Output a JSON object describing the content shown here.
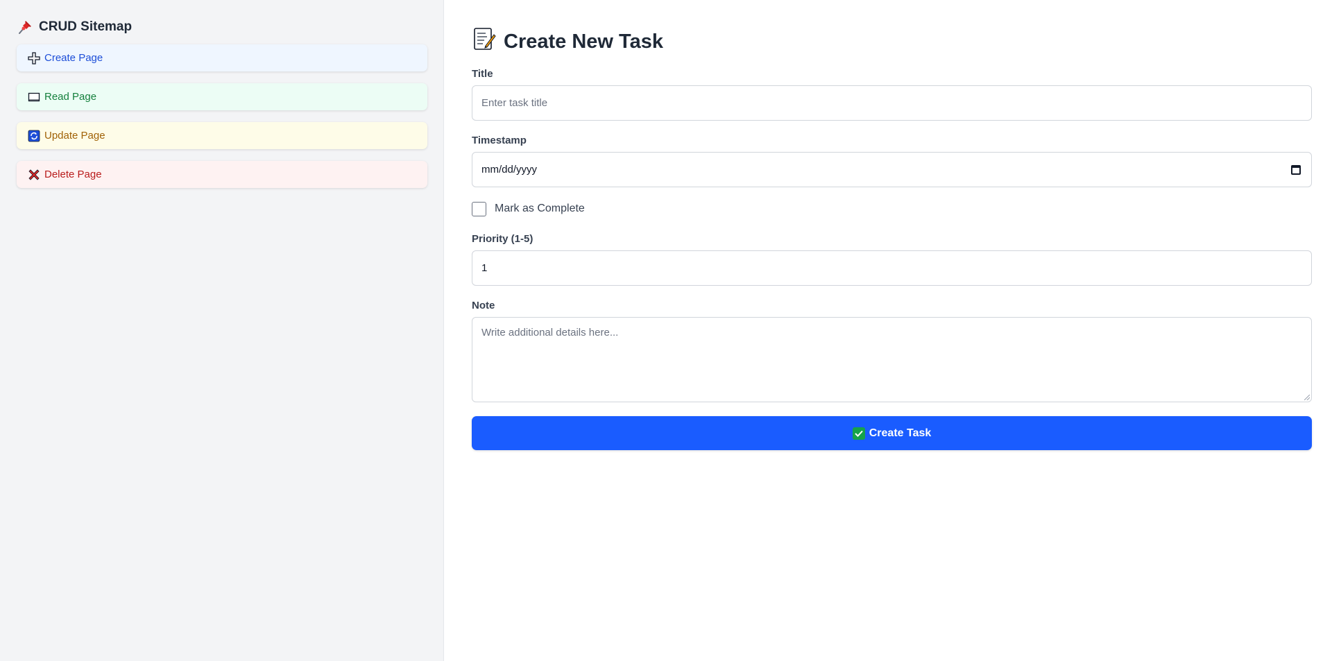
{
  "sidebar": {
    "title": "CRUD Sitemap",
    "title_icon": "pushpin-icon",
    "items": [
      {
        "label": "Create Page",
        "icon": "plus-icon",
        "color": "#1d4ed8",
        "bg": "#eff6ff"
      },
      {
        "label": "Read Page",
        "icon": "book-icon",
        "color": "#15803d",
        "bg": "#ecfdf5"
      },
      {
        "label": "Update Page",
        "icon": "refresh-icon",
        "color": "#a16207",
        "bg": "#fefce8"
      },
      {
        "label": "Delete Page",
        "icon": "cross-icon",
        "color": "#b91c1c",
        "bg": "#fef2f2"
      }
    ]
  },
  "main": {
    "title": "Create New Task",
    "title_icon": "memo-icon",
    "form": {
      "title_label": "Title",
      "title_placeholder": "Enter task title",
      "timestamp_label": "Timestamp",
      "timestamp_placeholder": "mm/dd/yyyy",
      "complete_label": "Mark as Complete",
      "complete_checked": false,
      "priority_label": "Priority (1-5)",
      "priority_value": "1",
      "note_label": "Note",
      "note_placeholder": "Write additional details here...",
      "submit_label": "Create Task",
      "submit_color": "#1a5cff"
    }
  }
}
